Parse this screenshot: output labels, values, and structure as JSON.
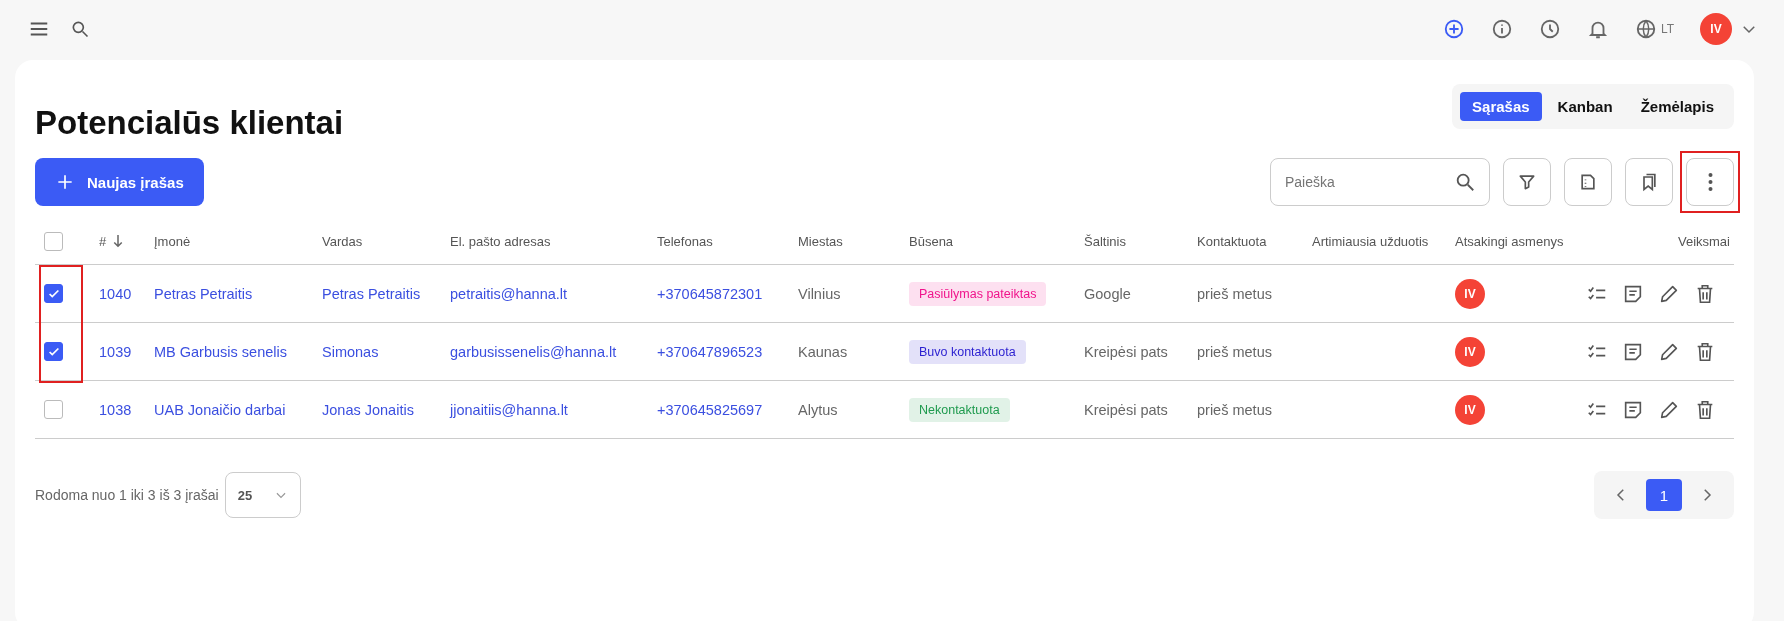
{
  "topbar": {
    "language": "LT",
    "user_initials": "IV"
  },
  "page": {
    "title": "Potencialūs klientai"
  },
  "views": [
    {
      "label": "Sąrašas",
      "selected": true
    },
    {
      "label": "Kanban",
      "selected": false
    },
    {
      "label": "Žemėlapis",
      "selected": false
    }
  ],
  "toolbar": {
    "new_button": "Naujas įrašas",
    "search": {
      "placeholder": "Paieška"
    },
    "more_highlighted": true
  },
  "table": {
    "selection_highlighted": true,
    "all_checked": false,
    "columns": [
      {
        "label": "#",
        "sorted": true
      },
      {
        "label": "Įmonė",
        "sorted": false
      },
      {
        "label": "Vardas",
        "sorted": false
      },
      {
        "label": "El. pašto adresas",
        "sorted": false
      },
      {
        "label": "Telefonas",
        "sorted": false
      },
      {
        "label": "Miestas",
        "sorted": false
      },
      {
        "label": "Būsena",
        "sorted": false
      },
      {
        "label": "Šaltinis",
        "sorted": false
      },
      {
        "label": "Kontaktuota",
        "sorted": false
      },
      {
        "label": "Artimiausia užduotis",
        "sorted": false
      },
      {
        "label": "Atsakingi asmenys",
        "sorted": false
      },
      {
        "label": "Veiksmai",
        "sorted": false
      }
    ],
    "rows": [
      {
        "checked": true,
        "id": "1040",
        "company": "Petras Petraitis",
        "name": "Petras Petraitis",
        "email": "petraitis@hanna.lt",
        "phone": "+370645872301",
        "city": "Vilnius",
        "status": {
          "label": "Pasiūlymas pateiktas",
          "color": "#f0148c"
        },
        "source": "Google",
        "contacted": "prieš metus",
        "owner": "IV"
      },
      {
        "checked": true,
        "id": "1039",
        "company": "MB Garbusis senelis",
        "name": "Simonas",
        "email": "garbusissenelis@hanna.lt",
        "phone": "+370647896523",
        "city": "Kaunas",
        "status": {
          "label": "Buvo kontaktuota",
          "color": "#2a1fd0"
        },
        "source": "Kreipėsi pats",
        "contacted": "prieš metus",
        "owner": "IV"
      },
      {
        "checked": false,
        "id": "1038",
        "company": "UAB Jonaičio darbai",
        "name": "Jonas Jonaitis",
        "email": "jjonaitiis@hanna.lt",
        "phone": "+370645825697",
        "city": "Alytus",
        "status": {
          "label": "Nekontaktuota",
          "color": "#1e9a4e"
        },
        "source": "Kreipėsi pats",
        "contacted": "prieš metus",
        "owner": "IV"
      }
    ]
  },
  "footer": {
    "summary": "Rodoma nuo 1 iki 3 iš 3 įrašai",
    "page_size": "25",
    "pages": [
      {
        "label": "1",
        "selected": true
      }
    ]
  }
}
